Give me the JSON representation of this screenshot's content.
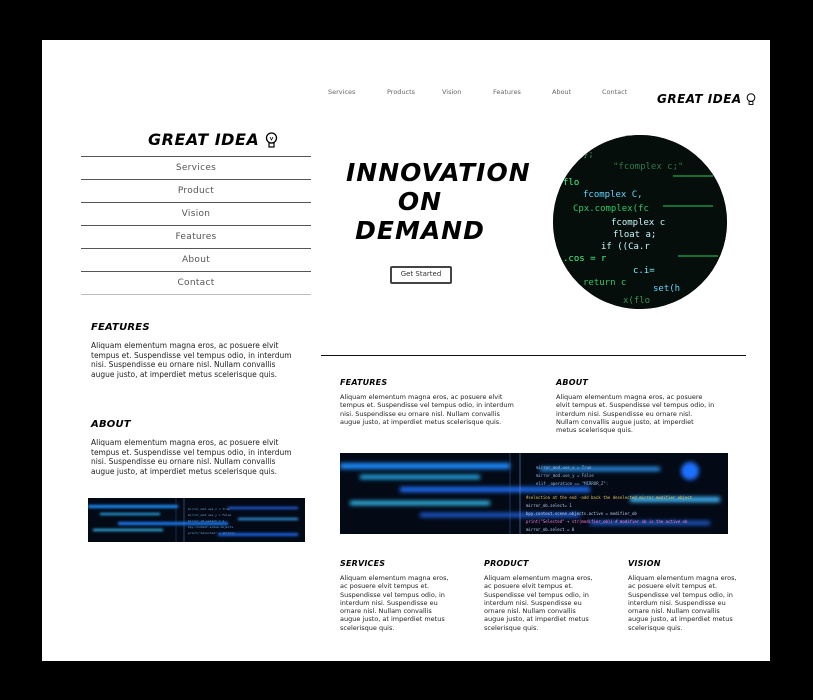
{
  "brand": {
    "logo_text": "GREAT IDEA"
  },
  "top_nav": {
    "items": [
      "Services",
      "Products",
      "Vision",
      "Features",
      "About",
      "Contact"
    ]
  },
  "mobile_nav": {
    "items": [
      "Services",
      "Product",
      "Vision",
      "Features",
      "About",
      "Contact"
    ]
  },
  "hero": {
    "line1": "INNOVATION",
    "line2": "ON",
    "line3": "DEMAND",
    "cta_label": "Get Started"
  },
  "left_sections": [
    {
      "title": "FEATURES",
      "body": "Aliquam elementum magna eros, ac posuere elvit tempus et. Suspendisse vel tempus odio, in interdum nisi. Suspendisse eu ornare nisl. Nullam convallis augue justo, at imperdiet metus scelerisque quis."
    },
    {
      "title": "ABOUT",
      "body": "Aliquam elementum magna eros, ac posuere elvit tempus et. Suspendisse vel tempus odio, in interdum nisi. Suspendisse eu ornare nisl. Nullam convallis augue justo, at imperdiet metus scelerisque quis."
    }
  ],
  "mid_sections": [
    {
      "title": "FEATURES",
      "body": "Aliquam elementum magna eros, ac posuere elvit tempus et. Suspendisse vel tempus odio, in interdum nisi. Suspendisse eu ornare nisl. Nullam convallis augue justo, at imperdiet metus scelerisque quis."
    },
    {
      "title": "ABOUT",
      "body": "Aliquam elementum magna eros, ac posuere elvit tempus et. Suspendisse vel tempus odio, in interdum nisi. Suspendisse eu ornare nisl. Nullam convallis augue justo, at imperdiet metus scelerisque quis."
    }
  ],
  "bottom_sections": [
    {
      "title": "SERVICES",
      "body": "Aliquam elementum magna eros, ac posuere elvit tempus et. Suspendisse vel tempus odio, in interdum nisi. Suspendisse eu ornare nisl. Nullam convallis augue justo, at imperdiet metus scelerisque quis."
    },
    {
      "title": "PRODUCT",
      "body": "Aliquam elementum magna eros, ac posuere elvit tempus et. Suspendisse vel tempus odio, in interdum nisi. Suspendisse eu ornare nisl. Nullam convallis augue justo, at imperdiet metus scelerisque quis."
    },
    {
      "title": "VISION",
      "body": "Aliquam elementum magna eros, ac posuere elvit tempus et. Suspendisse vel tempus odio, in interdum nisi. Suspendisse eu ornare nisl. Nullam convallis augue justo, at imperdiet metus scelerisque quis."
    }
  ],
  "images": {
    "hero_circle": "code-screen-photo",
    "wide_banner": "blue-code-blur-photo",
    "small_banner": "blue-code-blur-photo"
  },
  "colors": {
    "page_bg": "#000000",
    "sheet_bg": "#ffffff",
    "code_green": "#3cff8a",
    "code_blue": "#27a9ff"
  }
}
